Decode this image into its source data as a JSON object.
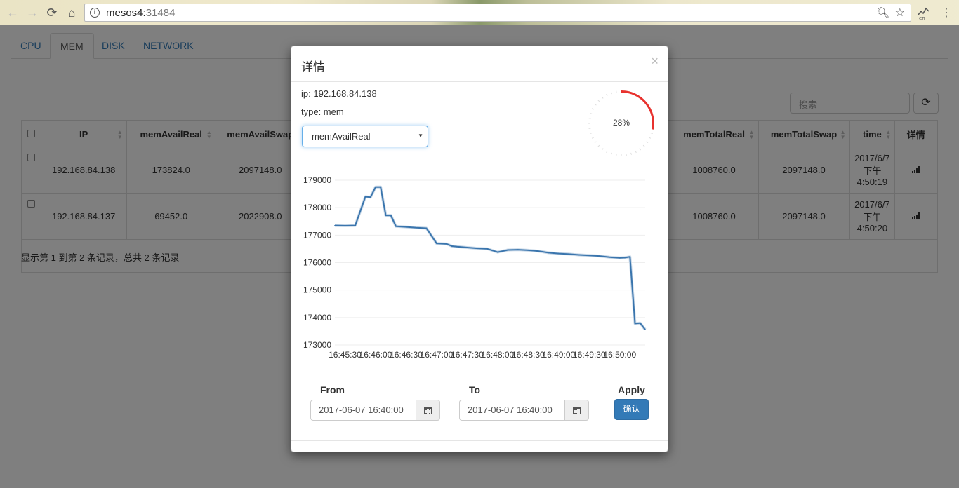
{
  "browser": {
    "url_host": "mesos4:",
    "url_port": "31484"
  },
  "tabs": [
    "CPU",
    "MEM",
    "DISK",
    "NETWORK"
  ],
  "active_tab": "MEM",
  "search_placeholder": "搜索",
  "table": {
    "headers": [
      "IP",
      "memAvailReal",
      "memAvailSwap",
      "memTotalReal",
      "memTotalSwap",
      "time",
      "详情"
    ],
    "rows": [
      {
        "ip": "192.168.84.138",
        "memAvailReal": "173824.0",
        "memAvailSwap": "2097148.0",
        "memTotalReal": "1008760.0",
        "memTotalSwap": "2097148.0",
        "time_l1": "2017/6/7",
        "time_l2": "下午",
        "time_l3": "4:50:19"
      },
      {
        "ip": "192.168.84.137",
        "memAvailReal": "69452.0",
        "memAvailSwap": "2022908.0",
        "memTotalReal": "1008760.0",
        "memTotalSwap": "2097148.0",
        "time_l1": "2017/6/7",
        "time_l2": "下午",
        "time_l3": "4:50:20"
      }
    ],
    "pagination_info": "显示第 1 到第 2 条记录，总共 2 条记录"
  },
  "modal": {
    "title": "详情",
    "close": "×",
    "ip_line": "ip: 192.168.84.138",
    "type_line": "type: mem",
    "selected_metric": "memAvailReal",
    "gauge_value": 28,
    "gauge_text": "28%",
    "gauge_color": "#e8322e",
    "from_label": "From",
    "to_label": "To",
    "apply_label": "Apply",
    "from_value": "2017-06-07 16:40:00",
    "to_value": "2017-06-07 16:40:00",
    "confirm_label": "确认"
  },
  "chart_data": {
    "type": "line",
    "title": "",
    "xlabel": "",
    "ylabel": "",
    "ylim": [
      173000,
      179000
    ],
    "yticks": [
      "179000",
      "178000",
      "177000",
      "176000",
      "175000",
      "174000",
      "173000"
    ],
    "xticks": [
      "16:45:30",
      "16:46:00",
      "16:46:30",
      "16:47:00",
      "16:47:30",
      "16:48:00",
      "16:48:30",
      "16:49:00",
      "16:49:30",
      "16:50:00"
    ],
    "line_color": "#3a75ad",
    "series": [
      {
        "x": [
          "16:45:20",
          "16:45:30",
          "16:45:40",
          "16:45:50",
          "16:45:55",
          "16:46:00",
          "16:46:05",
          "16:46:10",
          "16:46:15",
          "16:46:20",
          "16:46:30",
          "16:46:40",
          "16:46:50",
          "16:47:00",
          "16:47:05",
          "16:47:10",
          "16:47:15",
          "16:47:20",
          "16:47:30",
          "16:47:40",
          "16:47:50",
          "16:48:00",
          "16:48:10",
          "16:48:20",
          "16:48:30",
          "16:48:40",
          "16:48:50",
          "16:49:00",
          "16:49:10",
          "16:49:20",
          "16:49:30",
          "16:49:40",
          "16:49:50",
          "16:50:00",
          "16:50:05",
          "16:50:10",
          "16:50:15",
          "16:50:20",
          "16:50:25"
        ],
        "y": [
          177350,
          177340,
          177350,
          178400,
          178380,
          178750,
          178750,
          177720,
          177720,
          177320,
          177300,
          177270,
          177250,
          176700,
          176690,
          176680,
          176600,
          176580,
          176550,
          176520,
          176500,
          176380,
          176460,
          176470,
          176450,
          176420,
          176360,
          176330,
          176310,
          176280,
          176260,
          176240,
          176200,
          176170,
          176180,
          176210,
          173780,
          173800,
          173560
        ]
      }
    ]
  }
}
